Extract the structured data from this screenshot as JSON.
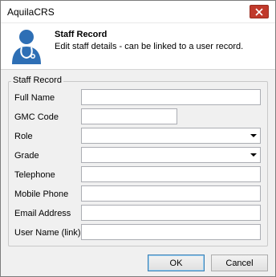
{
  "window": {
    "title": "AquilaCRS",
    "close_icon": "close-icon"
  },
  "header": {
    "title": "Staff Record",
    "subtitle": "Edit staff details - can be linked to a user record.",
    "icon": "staff-user-icon",
    "icon_color": "#2e6fb5"
  },
  "group": {
    "legend": "Staff Record"
  },
  "fields": {
    "full_name": {
      "label": "Full Name",
      "value": ""
    },
    "gmc_code": {
      "label": "GMC Code",
      "value": ""
    },
    "role": {
      "label": "Role",
      "value": ""
    },
    "grade": {
      "label": "Grade",
      "value": ""
    },
    "telephone": {
      "label": "Telephone",
      "value": ""
    },
    "mobile_phone": {
      "label": "Mobile Phone",
      "value": ""
    },
    "email_address": {
      "label": "Email Address",
      "value": ""
    },
    "user_name": {
      "label": "User Name (link)",
      "value": ""
    }
  },
  "buttons": {
    "ok": "OK",
    "cancel": "Cancel"
  },
  "colors": {
    "close_button": "#c0392b",
    "ok_border": "#3c7fb1"
  }
}
